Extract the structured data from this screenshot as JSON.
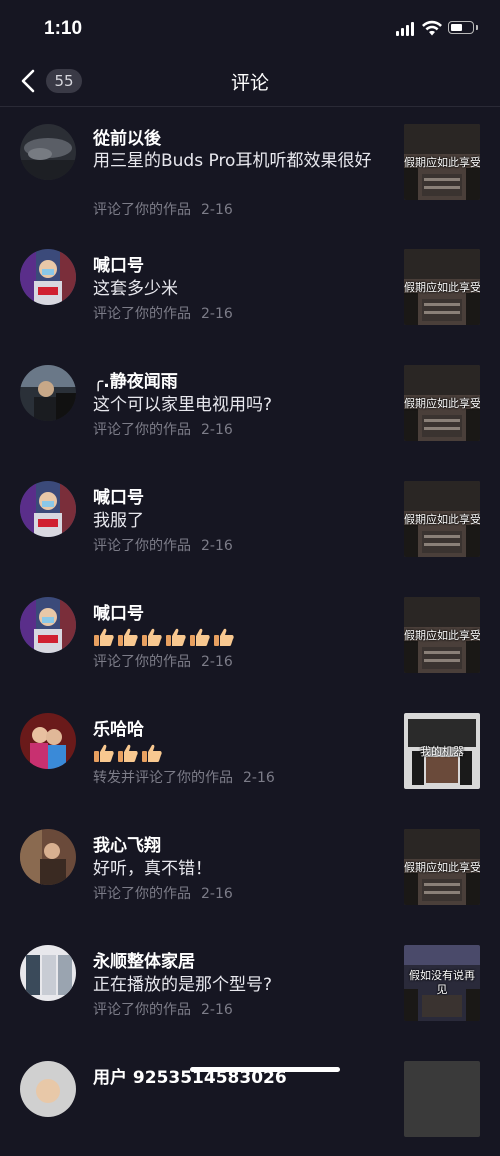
{
  "status_bar": {
    "time": "1:10"
  },
  "header": {
    "back_count": "55",
    "title": "评论"
  },
  "comments": [
    {
      "name": "從前以後",
      "text": "用三星的Buds Pro耳机听都效果很好",
      "meta": "评论了你的作品",
      "date": "2-16",
      "thumb_caption": "假期应如此享受",
      "avatar": "storm-avatar"
    },
    {
      "name": "喊口号",
      "text": "这套多少米",
      "meta": "评论了你的作品",
      "date": "2-16",
      "thumb_caption": "假期应如此享受",
      "avatar": "masked-man-avatar"
    },
    {
      "name": "╭.静夜闻雨",
      "text": "这个可以家里电视用吗?",
      "meta": "评论了你的作品",
      "date": "2-16",
      "thumb_caption": "假期应如此享受",
      "avatar": "driver-avatar"
    },
    {
      "name": "喊口号",
      "text": "我服了",
      "meta": "评论了你的作品",
      "date": "2-16",
      "thumb_caption": "假期应如此享受",
      "avatar": "masked-man-avatar"
    },
    {
      "name": "喊口号",
      "text": "",
      "emoji_thumbs": 6,
      "meta": "评论了你的作品",
      "date": "2-16",
      "thumb_caption": "假期应如此享受",
      "avatar": "masked-man-avatar"
    },
    {
      "name": "乐哈哈",
      "text": "",
      "emoji_thumbs": 3,
      "meta": "转发并评论了你的作品",
      "date": "2-16",
      "thumb_caption": "我的机器",
      "avatar": "couple-avatar"
    },
    {
      "name": "我心飞翔",
      "text": "好听，真不错！",
      "meta": "评论了你的作品",
      "date": "2-16",
      "thumb_caption": "假期应如此享受",
      "avatar": "man-avatar"
    },
    {
      "name": "永顺整体家居",
      "text": "正在播放的是那个型号?",
      "meta": "评论了你的作品",
      "date": "2-16",
      "thumb_caption": "假如没有说再见",
      "avatar": "furniture-avatar"
    },
    {
      "name": "用户 9253514583026",
      "text": "",
      "meta": "",
      "date": "",
      "thumb_caption": "",
      "avatar": "user-avatar"
    }
  ],
  "colors": {
    "background": "#161622",
    "meta": "#7c7c88",
    "badge": "#3a3a46"
  }
}
